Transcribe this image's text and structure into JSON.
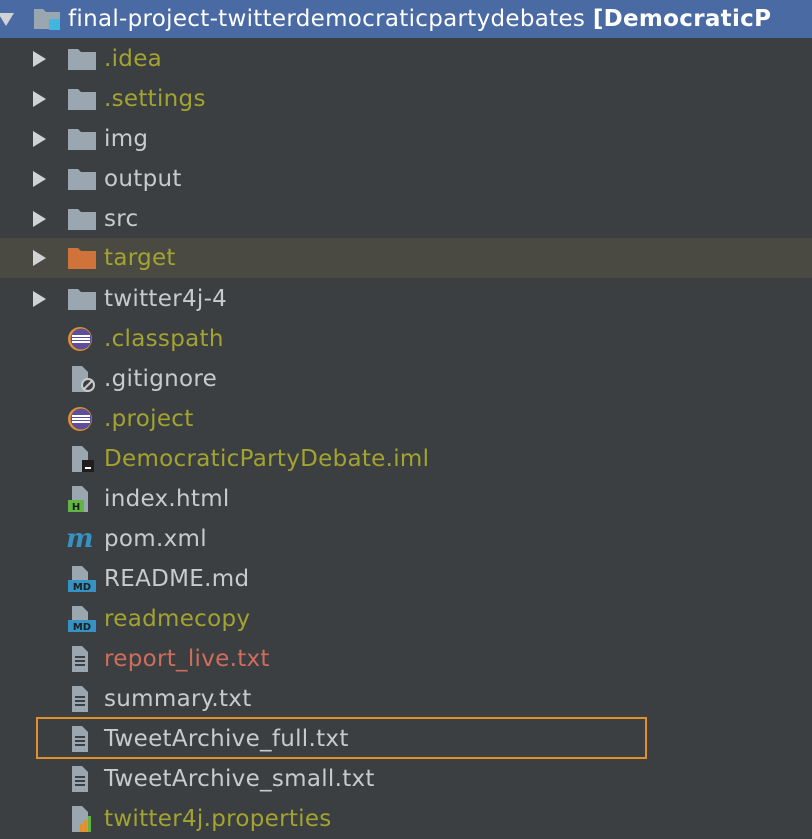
{
  "root": {
    "name": "final-project-twitterdemocraticpartydebates",
    "module": "[DemocraticP"
  },
  "items": [
    {
      "label": ".idea",
      "icon": "folder-icon",
      "color": "olive",
      "expandable": true
    },
    {
      "label": ".settings",
      "icon": "folder-icon",
      "color": "olive",
      "expandable": true
    },
    {
      "label": "img",
      "icon": "folder-icon",
      "color": "default",
      "expandable": true
    },
    {
      "label": "output",
      "icon": "folder-icon",
      "color": "default",
      "expandable": true
    },
    {
      "label": "src",
      "icon": "folder-icon",
      "color": "default",
      "expandable": true
    },
    {
      "label": "target",
      "icon": "excluded-folder-icon",
      "color": "olive",
      "expandable": true
    },
    {
      "label": "twitter4j-4",
      "icon": "folder-icon",
      "color": "default",
      "expandable": true
    },
    {
      "label": ".classpath",
      "icon": "eclipse-icon",
      "color": "olive",
      "expandable": false
    },
    {
      "label": ".gitignore",
      "icon": "ignore-file-icon",
      "color": "default",
      "expandable": false
    },
    {
      "label": ".project",
      "icon": "eclipse-icon",
      "color": "olive",
      "expandable": false
    },
    {
      "label": "DemocraticPartyDebate.iml",
      "icon": "iml-file-icon",
      "color": "olive",
      "expandable": false
    },
    {
      "label": "index.html",
      "icon": "html-file-icon",
      "color": "default",
      "expandable": false
    },
    {
      "label": "pom.xml",
      "icon": "maven-icon",
      "color": "default",
      "expandable": false
    },
    {
      "label": "README.md",
      "icon": "markdown-file-icon",
      "color": "default",
      "expandable": false
    },
    {
      "label": "readmecopy",
      "icon": "markdown-file-icon",
      "color": "olive",
      "expandable": false
    },
    {
      "label": "report_live.txt",
      "icon": "text-file-icon",
      "color": "red",
      "expandable": false
    },
    {
      "label": "summary.txt",
      "icon": "text-file-icon",
      "color": "default",
      "expandable": false
    },
    {
      "label": "TweetArchive_full.txt",
      "icon": "text-file-icon",
      "color": "default",
      "expandable": false
    },
    {
      "label": "TweetArchive_small.txt",
      "icon": "text-file-icon",
      "color": "default",
      "expandable": false
    },
    {
      "label": "twitter4j.properties",
      "icon": "properties-file-icon",
      "color": "olive",
      "expandable": false
    }
  ],
  "colors": {
    "background": "#3c3f41",
    "root_highlight": "#4a6aa4",
    "target_row": "#4b4a42",
    "default_text": "#c8cbce",
    "olive_text": "#a3a32f",
    "red_text": "#cf6d5c",
    "selection_border": "#e0912c"
  }
}
